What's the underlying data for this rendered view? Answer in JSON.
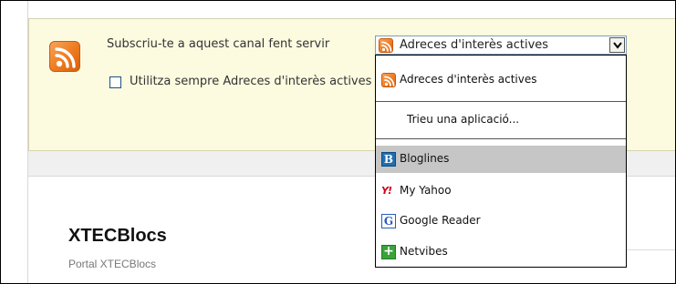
{
  "subscribe": {
    "label": "Subscriu-te a aquest canal fent servir",
    "always_label": "Utilitza sempre Adreces d'interès actives",
    "always_checked": false,
    "selected_option": "Adreces d'interès actives"
  },
  "dropdown": {
    "items": [
      {
        "label": "Adreces d'interès actives",
        "icon": "rss-feed-icon"
      },
      {
        "label": "Trieu una aplicació...",
        "icon": ""
      },
      {
        "label": "Bloglines",
        "icon": "bloglines-icon",
        "glyph": "B"
      },
      {
        "label": "My Yahoo",
        "icon": "yahoo-icon",
        "glyph": "Y!"
      },
      {
        "label": "Google Reader",
        "icon": "google-reader-icon",
        "glyph": "G"
      },
      {
        "label": "Netvibes",
        "icon": "netvibes-icon",
        "glyph": "+"
      }
    ],
    "highlighted": "Bloglines"
  },
  "blog": {
    "title": "XTECBlocs",
    "subtitle": "Portal XTECBlocs"
  },
  "colors": {
    "feed_orange": "#ee7a1e",
    "subscribe_background": "#fcfbe0",
    "highlight": "#c6c6c6"
  }
}
